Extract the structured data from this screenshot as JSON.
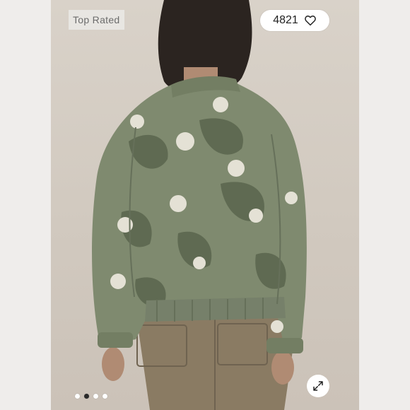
{
  "badge": {
    "label": "Top Rated"
  },
  "likes": {
    "count": "4821",
    "icon": "heart-outline-icon"
  },
  "carousel": {
    "total_dots": 4,
    "active_index": 1
  },
  "expand": {
    "icon": "expand-arrows-icon"
  },
  "colors": {
    "jacket": "#7f8a6f",
    "camo_dark": "#5f6a52",
    "flower": "#e4e1d5",
    "pants": "#8a7b63",
    "hair": "#2b2420"
  }
}
